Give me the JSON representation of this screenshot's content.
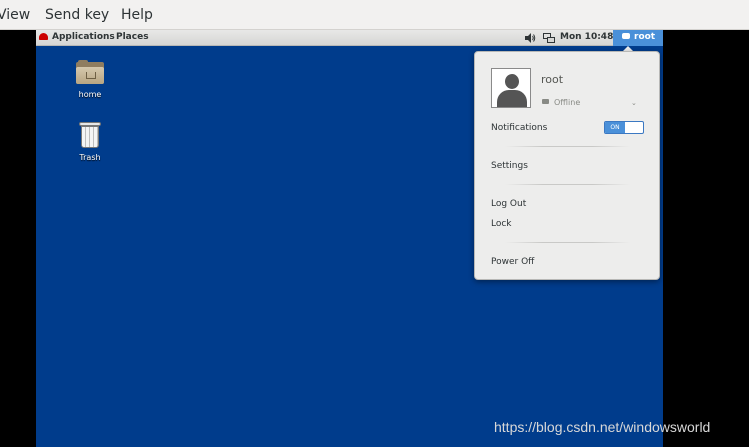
{
  "viewer_menu": {
    "items": [
      "View",
      "Send key",
      "Help"
    ]
  },
  "topbar": {
    "applications": "Applications",
    "places": "Places",
    "clock": "Mon 10:48",
    "user_button": "root",
    "icons": [
      "volume-icon",
      "network-icon"
    ]
  },
  "desktop": {
    "icons": [
      {
        "label": "home",
        "icon": "folder-home-icon"
      },
      {
        "label": "Trash",
        "icon": "trash-icon"
      }
    ]
  },
  "user_menu": {
    "username": "root",
    "status": "Offline",
    "notifications_label": "Notifications",
    "notifications_toggle": "ON",
    "settings": "Settings",
    "log_out": "Log Out",
    "lock": "Lock",
    "power_off": "Power Off"
  },
  "watermark": "https://blog.csdn.net/windowsworld",
  "colors": {
    "desktop_bg": "#003c8c",
    "accent": "#4a90d9"
  }
}
